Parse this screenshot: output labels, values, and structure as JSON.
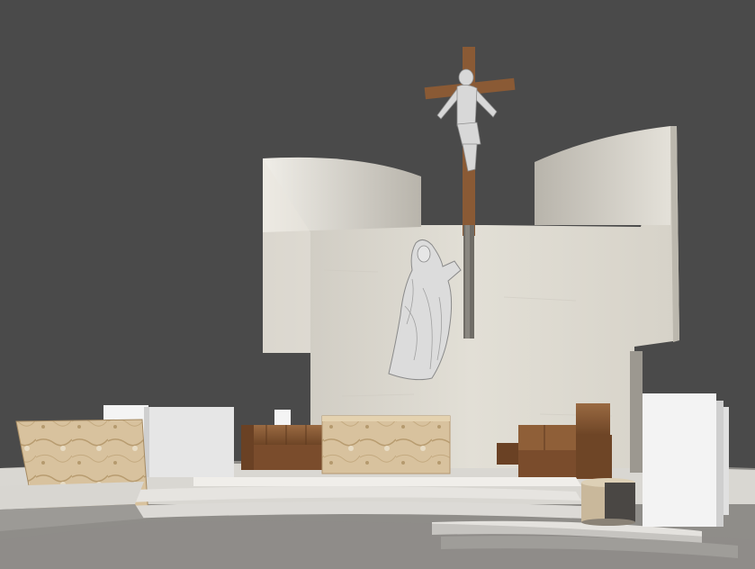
{
  "scene": {
    "colors": {
      "background": "#4a4a4a",
      "wall": "#dedbd2",
      "wall_shadow": "#c9c5bb",
      "wood": "#8a5a35",
      "wood_dark": "#5e3a1f",
      "marble": "#d7c09a",
      "floor": "#e8e6e2",
      "floor_shadow": "#a9a7a2",
      "white_block": "#f2f2f2"
    },
    "elements": {
      "crucifix": "crucifix-icon",
      "praying_figure": "praying-figure-icon",
      "altar": "altar-block",
      "ambo": "ambo-panel",
      "seats": "wooden-seats",
      "steps": "curved-steps"
    }
  }
}
